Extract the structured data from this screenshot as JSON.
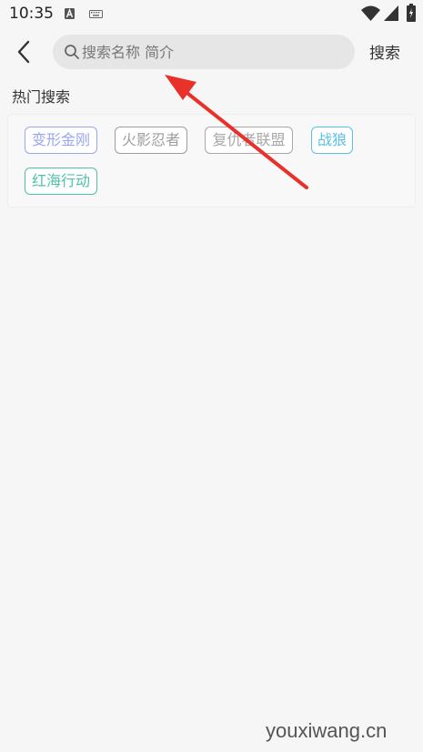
{
  "status_bar": {
    "time": "10:35",
    "icons": [
      "text-a-icon",
      "keyboard-icon",
      "wifi-icon",
      "signal-icon",
      "battery-icon"
    ]
  },
  "header": {
    "back_icon": "chevron-left-icon",
    "search_placeholder": "搜索名称 简介",
    "search_value": "",
    "search_button_label": "搜索"
  },
  "hot_search": {
    "title": "热门搜索",
    "tags": [
      {
        "label": "变形金刚",
        "color": "#9aa6f0"
      },
      {
        "label": "火影忍者",
        "color": "#9d9d9d"
      },
      {
        "label": "复仇者联盟",
        "color": "#a8a8a8"
      },
      {
        "label": "战狼",
        "color": "#5bc0e6"
      },
      {
        "label": "红海行动",
        "color": "#4fc1aa"
      }
    ]
  },
  "annotation": {
    "icon": "red-arrow-icon",
    "color": "#e8312b"
  },
  "watermark": "youxiwang.cn",
  "colors": {
    "background": "#f6f6f6",
    "search_box": "#e6e6e6"
  }
}
